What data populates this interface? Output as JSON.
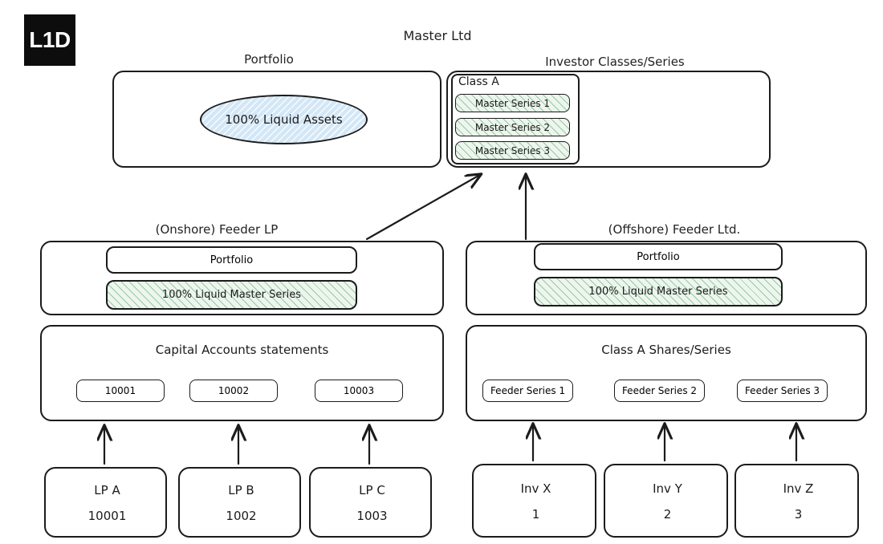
{
  "logo": {
    "text": "L1D"
  },
  "master": {
    "title": "Master Ltd",
    "portfolio": {
      "title": "Portfolio",
      "asset_label": "100% Liquid Assets"
    },
    "investor_classes": {
      "title": "Investor Classes/Series",
      "class_label": "Class A",
      "series": [
        "Master Series 1",
        "Master Series 2",
        "Master Series 3"
      ]
    }
  },
  "onshore": {
    "title": "(Onshore) Feeder LP",
    "portfolio_label": "Portfolio",
    "holding_label": "100% Liquid Master Series",
    "accounts_title": "Capital Accounts statements",
    "accounts": [
      "10001",
      "10002",
      "10003"
    ],
    "investors": [
      {
        "name": "LP A",
        "account": "10001"
      },
      {
        "name": "LP B",
        "account": "1002"
      },
      {
        "name": "LP C",
        "account": "1003"
      }
    ]
  },
  "offshore": {
    "title": "(Offshore) Feeder Ltd.",
    "portfolio_label": "Portfolio",
    "holding_label": "100% Liquid Master Series",
    "shares_title": "Class A Shares/Series",
    "series": [
      "Feeder Series 1",
      "Feeder Series 2",
      "Feeder Series 3"
    ],
    "investors": [
      {
        "name": "Inv X",
        "account": "1"
      },
      {
        "name": "Inv Y",
        "account": "2"
      },
      {
        "name": "Inv Z",
        "account": "3"
      }
    ]
  },
  "colors": {
    "stroke": "#1b1b1b",
    "green_fill": "#edf6ed",
    "green_hatch": "#56a06e",
    "blue_fill": "#d3e7f6",
    "logo_bg": "#0d0d0d"
  }
}
